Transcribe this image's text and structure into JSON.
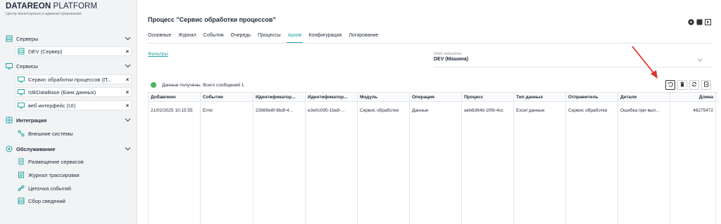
{
  "brand": {
    "name_bold": "DATAREON",
    "name_rest": " PLATFORM",
    "subtitle": "Центр мониторинга и администрирования"
  },
  "sidebar": {
    "sections": [
      {
        "label": "Серверы",
        "icon": "server-icon"
      },
      {
        "label": "Сервисы",
        "icon": "monitor-icon"
      },
      {
        "label": "Интеграция",
        "icon": "integration-icon"
      },
      {
        "label": "Обслуживание",
        "icon": "maintenance-icon"
      }
    ],
    "servers": [
      {
        "label": "DEV (Сервер)"
      }
    ],
    "services": [
      {
        "label": "Сервис обработки процессов (П..."
      },
      {
        "label": "IstkDataBase (Банк данных)"
      },
      {
        "label": "веб интерфейс (UI)"
      }
    ],
    "integration": [
      {
        "label": "Внешние системы"
      }
    ],
    "maintenance": [
      {
        "label": "Размещение сервисов"
      },
      {
        "label": "Журнал трассировки"
      },
      {
        "label": "Цепочка событий"
      },
      {
        "label": "Сбор сведений"
      }
    ]
  },
  "main": {
    "title": "Процесс \"Сервис обработки процессов\"",
    "tabs": [
      {
        "label": "Основные"
      },
      {
        "label": "Журнал"
      },
      {
        "label": "События"
      },
      {
        "label": "Очередь"
      },
      {
        "label": "Процессы"
      },
      {
        "label": "Архив"
      },
      {
        "label": "Конфигурация"
      },
      {
        "label": "Логирование"
      }
    ],
    "active_tab": "Архив",
    "filters_link": "Фильтры",
    "machine_label": "Имя машины",
    "machine_value": "DEV (Машина)",
    "status_text": "Данные получены. Всего сообщений 1",
    "accent_color": "#25a6a6",
    "status_color": "#49b85a"
  },
  "table": {
    "columns": [
      "Добавлено",
      "Событие",
      "Идентификатор...",
      "Идентификатор...",
      "Модуль",
      "Операция",
      "Процесс",
      "Тип данных",
      "Отправитель",
      "Детали",
      "Длина"
    ],
    "rows": [
      [
        "21/02/2025 10:15:55",
        "Error",
        "23989e8f-6bdf-4...",
        "e3e0c095-1ba9-...",
        "Сервис обработки",
        "Данные",
        "aeb6364d-1f06-4cc",
        "Excel данные",
        "Сервис обработки",
        "Ошибка при вып...",
        "46275472"
      ]
    ]
  }
}
